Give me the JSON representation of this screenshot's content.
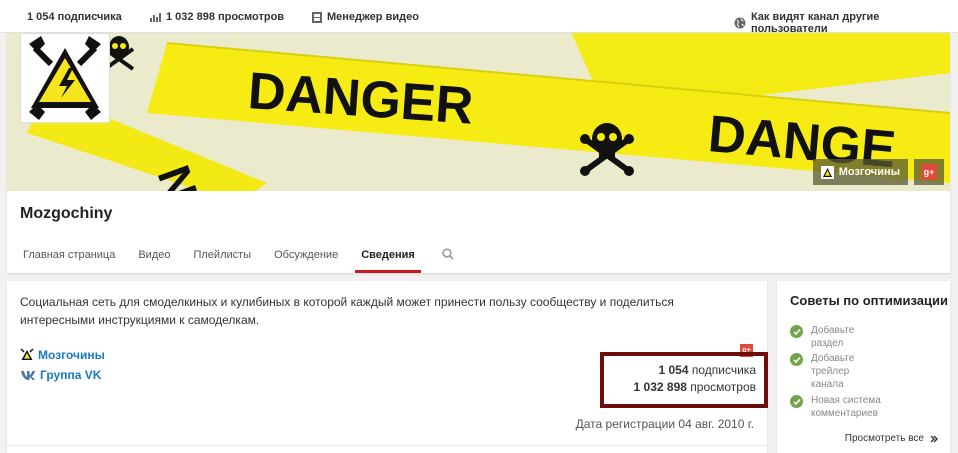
{
  "topbar": {
    "subscribers": "1 054 подписчика",
    "views": "1 032 898 просмотров",
    "video_manager": "Менеджер видео",
    "view_as": "Как видят канал другие пользователи"
  },
  "banner": {
    "words": [
      "DANGER",
      "DANGE",
      "NGE"
    ],
    "link_label": "Мозгочины",
    "accent_color": "#f3ec1f"
  },
  "channel": {
    "title": "Mozgochiny"
  },
  "tabs": [
    {
      "label": "Главная страница"
    },
    {
      "label": "Видео"
    },
    {
      "label": "Плейлисты"
    },
    {
      "label": "Обсуждение"
    },
    {
      "label": "Сведения"
    }
  ],
  "about": {
    "description": "Социальная сеть для смоделкиных и кулибиных в которой каждый может принести пользу сообществу и поделиться интересными инструкциями к самоделкам.",
    "links": [
      {
        "label": "Мозгочины"
      },
      {
        "label": "Группа VK"
      }
    ],
    "subscribers_count": "1 054",
    "subscribers_label": "подписчика",
    "views_count": "1 032 898",
    "views_label": "просмотров",
    "registered": "Дата регистрации 04 авг. 2010 г."
  },
  "tips": {
    "title": "Советы по оптимизации",
    "items": [
      {
        "text": "Добавьте раздел"
      },
      {
        "text": "Добавьте трейлер канала"
      },
      {
        "text": "Новая система комментариев"
      }
    ],
    "see_all": "Просмотреть все"
  }
}
